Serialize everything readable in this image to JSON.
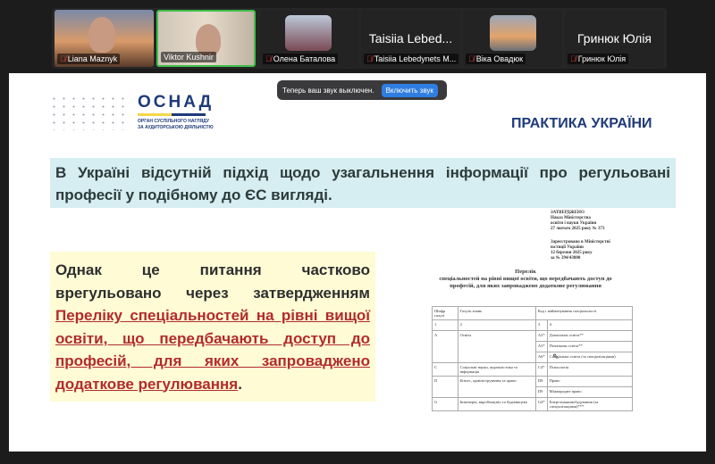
{
  "participants": [
    {
      "name": "Liana Maznyk",
      "muted": true,
      "video": true
    },
    {
      "name": "Viktor Kushnir",
      "muted": false,
      "video": true,
      "active_speaker": true
    },
    {
      "name": "Олена Баталова",
      "muted": true,
      "video": false
    },
    {
      "name": "Taisiia Lebedynets M...",
      "display": "Taisiia Lebed...",
      "muted": true,
      "video": false
    },
    {
      "name": "Віка Овадюк",
      "muted": true,
      "video": false
    },
    {
      "name": "Гринюк Юлія",
      "display": "Гринюк Юлія",
      "muted": true,
      "video": false
    }
  ],
  "toast": {
    "message": "Теперь ваш звук выключен.",
    "button": "Включить звук"
  },
  "slide": {
    "logo": {
      "title": "ОСНАД",
      "subtitle1": "ОРГАН СУСПІЛЬНОГО НАГЛЯДУ",
      "subtitle2": "ЗА АУДИТОРСЬКОЮ ДІЯЛЬНІСТЮ"
    },
    "title": "ПРАКТИКА УКРАЇНИ",
    "blue_text": "В Україні відсутній підхід щодо узагальнення інформації про регульовані професії у подібному до ЄС вигляді.",
    "yellow_text": "Однак це питання частково врегульовано через затвердженням",
    "yellow_link": "Переліку спеціальностей на рівні вищої освіти, що передбачають доступ до професій, для яких запроваджено додаткове регулювання",
    "yellow_end": ".",
    "doc": {
      "approve": [
        "ЗАТВЕРДЖЕНО",
        "Наказ Міністерства",
        "освіти і науки України",
        "27 лютого 2025 року № 373"
      ],
      "registered": [
        "Зареєстровано в Міністерстві",
        "юстиції України",
        "12 березня 2025 року",
        "за № 394/43800"
      ],
      "title": "Перелік",
      "subtitle": "спеціальностей на рівні вищої освіти, що передбачають доступ до професій, для яких запроваджено додаткове регулювання",
      "headers": [
        "Шифр галузі",
        "Галузь знань",
        "Код і найменування спеціальності"
      ],
      "numbers": [
        "1",
        "2",
        "3",
        "4"
      ],
      "rows": [
        [
          "A",
          "Освіта",
          "A2*",
          "Дошкільна освіта**"
        ],
        [
          "",
          "",
          "A3*",
          "Початкова освіта**"
        ],
        [
          "",
          "",
          "A6*",
          "Спеціальна освіта (за спеціалізаціями)"
        ],
        [
          "C",
          "Соціальні науки, журналістика та інформація",
          "C4*",
          "Психологія"
        ],
        [
          "D",
          "Бізнес, адміністрування та право",
          "D8",
          "Право"
        ],
        [
          "",
          "",
          "D9",
          "Міжнародне право"
        ],
        [
          "G",
          "Інженерія, виробництво та будівництво",
          "G4*",
          "Енергомашинобудування (за спеціалізаціями)***"
        ]
      ]
    }
  }
}
